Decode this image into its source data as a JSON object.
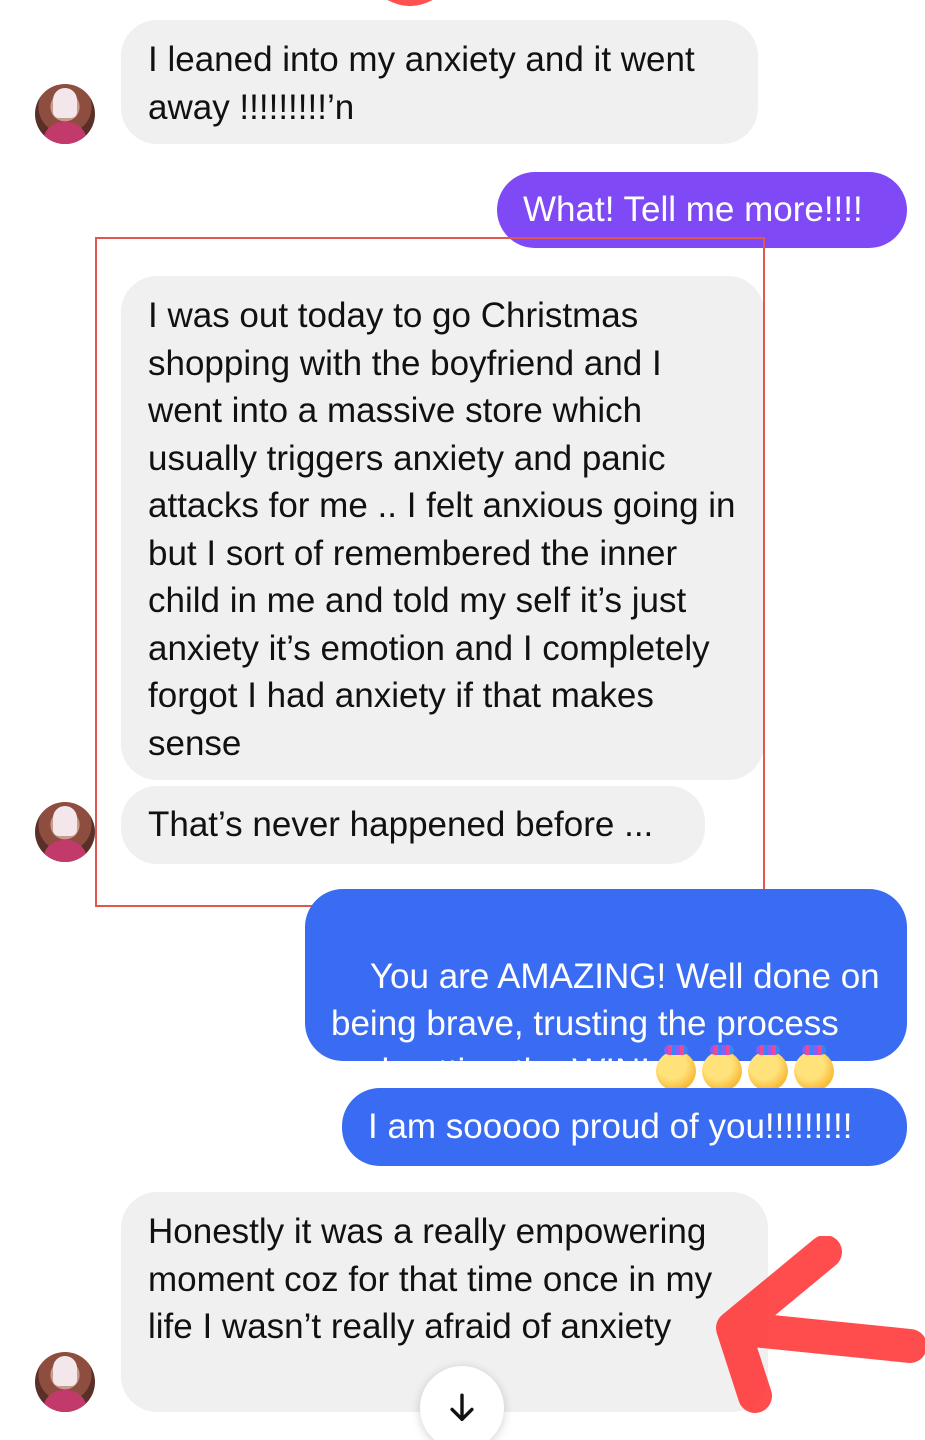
{
  "messages": [
    {
      "sender": "them",
      "text": "I leaned into my anxiety and it went away !!!!!!!!!’n"
    },
    {
      "sender": "me",
      "text": "What! Tell me more!!!!"
    },
    {
      "sender": "them",
      "text": "I was out today to go Christmas shopping with the boyfriend and I went into a massive store which usually triggers anxiety and panic attacks for me .. I felt anxious going in but I sort of remembered the inner child in me and told my self it’s just anxiety it’s emotion and I completely forgot I had anxiety if that makes sense"
    },
    {
      "sender": "them",
      "text": "That’s never happened before ..."
    },
    {
      "sender": "me",
      "text": "You are AMAZING! Well done on being brave, trusting the process and getting the WIN!",
      "emoji_count": 4,
      "emoji_icon": "partying-face-emoji"
    },
    {
      "sender": "me",
      "text": "I am sooooo proud of you!!!!!!!!!"
    },
    {
      "sender": "them",
      "text": "Honestly it was a really empowering moment coz for that time once in my life I wasn’t really afraid of anxiety"
    }
  ],
  "colors": {
    "incoming_bubble": "#f0f0f0",
    "outgoing_purple": "#7f4af5",
    "outgoing_blue": "#3a6cf3",
    "annotation_red": "#e2574c"
  },
  "icons": {
    "scroll": "arrow-down-icon",
    "avatar": "contact-avatar"
  }
}
